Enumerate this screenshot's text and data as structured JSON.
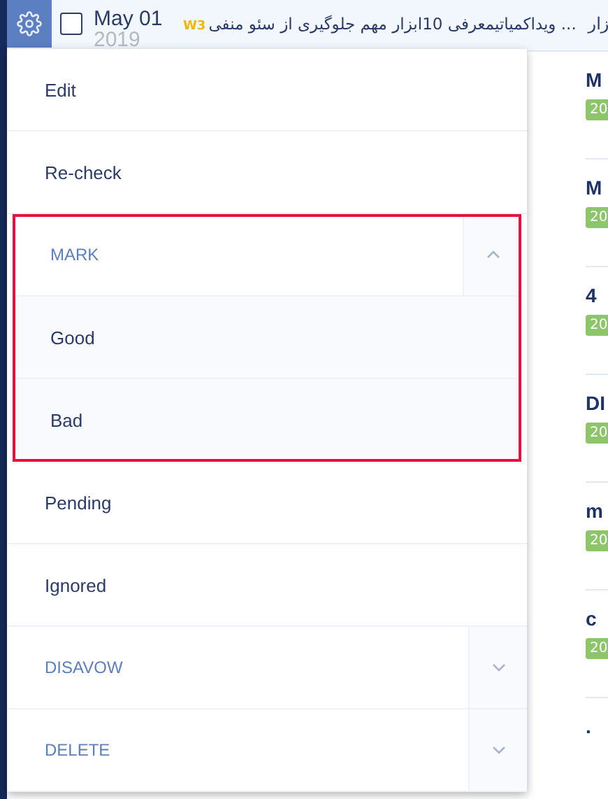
{
  "top_row": {
    "checked": false,
    "date": "May 01",
    "year": "2019",
    "badge": "W3",
    "title": "... ویداکمیاتیمعرفی 10ابزار مهم جلوگیری از سئو منفی",
    "next_title": "زار"
  },
  "list_rows": [
    {
      "title": "M",
      "tag": "20"
    },
    {
      "title": "M",
      "tag": "20"
    },
    {
      "title": "4",
      "tag": "20"
    },
    {
      "title": "DI",
      "tag": "20"
    },
    {
      "title": "m",
      "tag": "20"
    },
    {
      "title": "c",
      "tag": "20"
    },
    {
      "title": "."
    }
  ],
  "menu": [
    {
      "kind": "item",
      "label": "Edit"
    },
    {
      "kind": "item",
      "label": "Re-check"
    },
    {
      "kind": "section",
      "label": "MARK",
      "expanded": true,
      "highlighted": true,
      "children": [
        {
          "label": "Good"
        },
        {
          "label": "Bad"
        }
      ]
    },
    {
      "kind": "item",
      "label": "Pending"
    },
    {
      "kind": "item",
      "label": "Ignored"
    },
    {
      "kind": "section",
      "label": "DISAVOW",
      "expanded": false,
      "highlighted": false
    },
    {
      "kind": "section",
      "label": "DELETE",
      "expanded": false,
      "highlighted": false
    }
  ]
}
